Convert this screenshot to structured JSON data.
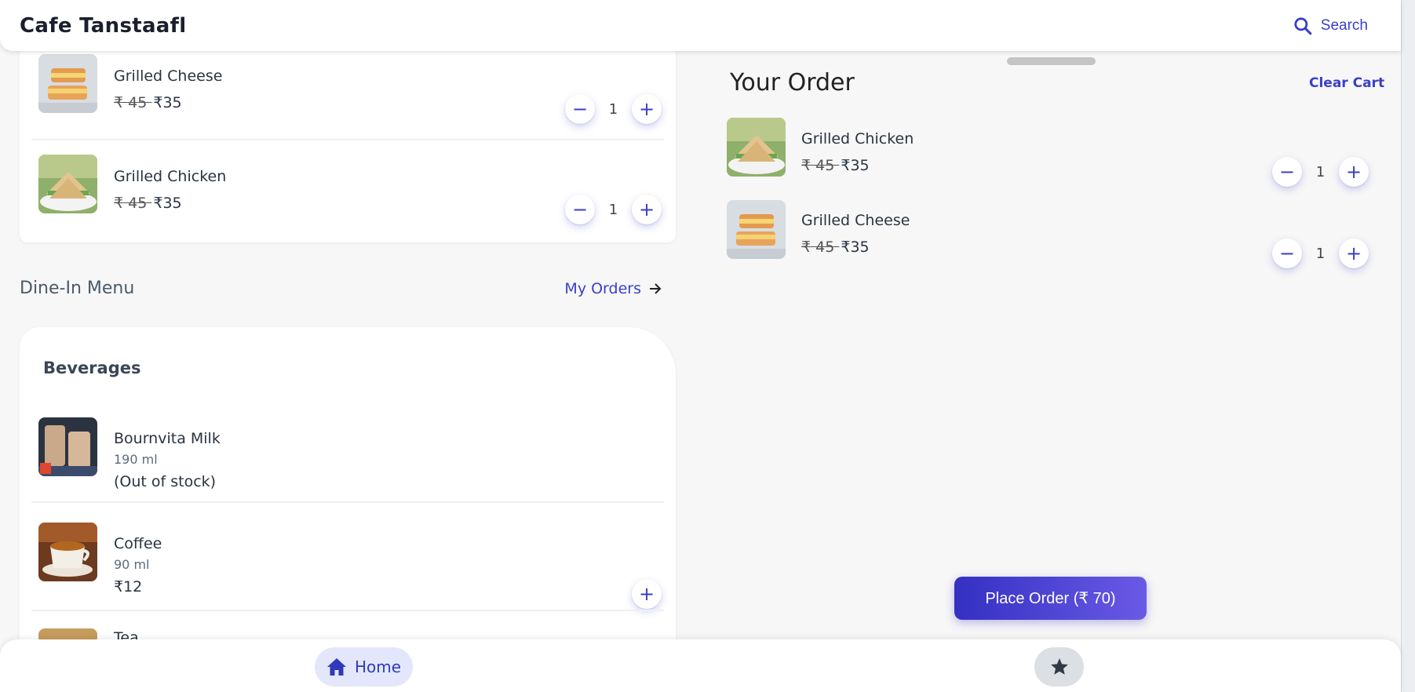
{
  "app": {
    "title": "Cafe Tanstaafl"
  },
  "header": {
    "search_label": "Search"
  },
  "cart_items_top": [
    {
      "name": "Grilled Cheese",
      "price_old": "₹ 45 ",
      "price_new": "₹35",
      "qty": "1"
    },
    {
      "name": "Grilled Chicken",
      "price_old": "₹ 45 ",
      "price_new": "₹35",
      "qty": "1"
    }
  ],
  "dine_in": {
    "title": "Dine-In Menu",
    "my_orders_label": "My Orders"
  },
  "menu": {
    "category": "Beverages",
    "items": [
      {
        "name": "Bournvita Milk",
        "volume": "190 ml",
        "status": "(Out of stock)"
      },
      {
        "name": "Coffee",
        "volume": "90 ml",
        "price": "₹12"
      },
      {
        "name": "Tea"
      }
    ]
  },
  "order": {
    "title": "Your Order",
    "clear_label": "Clear Cart",
    "items": [
      {
        "name": "Grilled Chicken",
        "price_old": "₹ 45 ",
        "price_new": "₹35",
        "qty": "1"
      },
      {
        "name": "Grilled Cheese",
        "price_old": "₹ 45 ",
        "price_new": "₹35",
        "qty": "1"
      }
    ],
    "place_order_label": "Place Order (₹ 70)"
  },
  "bottom_nav": {
    "home_label": "Home"
  },
  "colors": {
    "accent": "#3a3fc7",
    "gradient_start": "#3430c2",
    "gradient_end": "#6a5ae6"
  },
  "icons": [
    "search-icon",
    "minus-icon",
    "plus-icon",
    "arrow-right-icon",
    "home-icon",
    "star-icon"
  ]
}
